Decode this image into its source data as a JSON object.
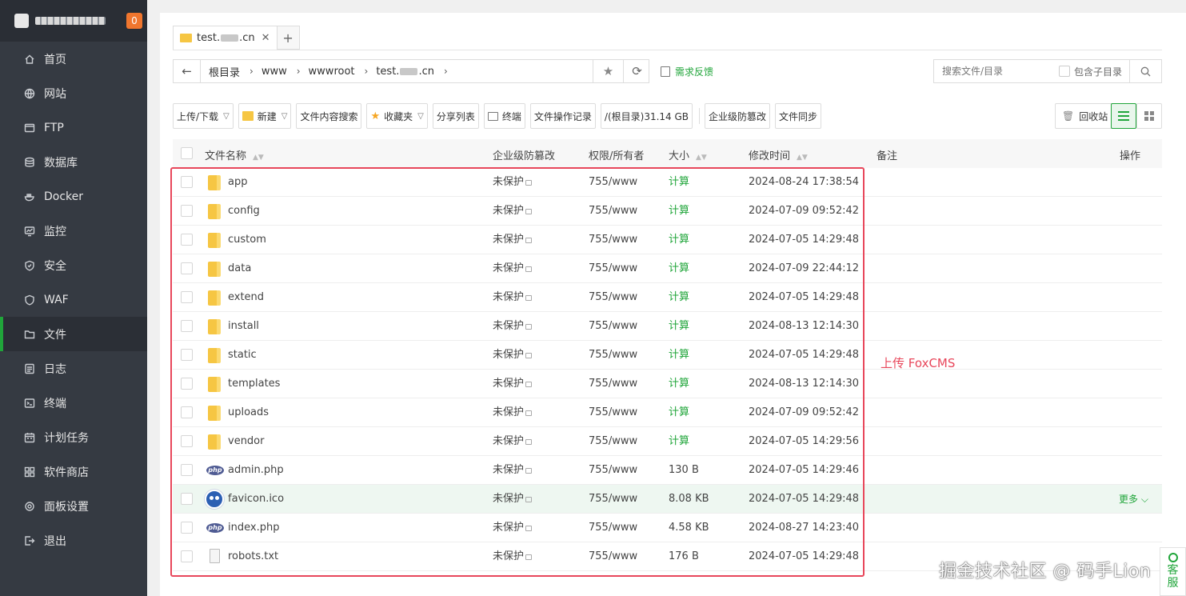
{
  "sidebar": {
    "badge": "0",
    "items": [
      {
        "label": "首页",
        "icon": "home-icon"
      },
      {
        "label": "网站",
        "icon": "globe-icon"
      },
      {
        "label": "FTP",
        "icon": "ftp-icon"
      },
      {
        "label": "数据库",
        "icon": "database-icon"
      },
      {
        "label": "Docker",
        "icon": "docker-icon"
      },
      {
        "label": "监控",
        "icon": "monitor-icon"
      },
      {
        "label": "安全",
        "icon": "shield-icon"
      },
      {
        "label": "WAF",
        "icon": "waf-icon"
      },
      {
        "label": "文件",
        "icon": "folder-icon"
      },
      {
        "label": "日志",
        "icon": "log-icon"
      },
      {
        "label": "终端",
        "icon": "terminal-icon"
      },
      {
        "label": "计划任务",
        "icon": "calendar-icon"
      },
      {
        "label": "软件商店",
        "icon": "apps-icon"
      },
      {
        "label": "面板设置",
        "icon": "gear-icon"
      },
      {
        "label": "退出",
        "icon": "logout-icon"
      }
    ],
    "active_index": 8
  },
  "tabs": {
    "current_prefix": "test.",
    "current_suffix": ".cn",
    "close": "✕",
    "add": "+"
  },
  "path": {
    "back": "←",
    "crumbs": [
      "根目录",
      "www",
      "wwwroot"
    ],
    "last_prefix": "test.",
    "last_suffix": ".cn",
    "star": "★",
    "refresh": "⟳"
  },
  "feedback": "需求反馈",
  "search": {
    "placeholder": "搜索文件/目录",
    "include_sub": "包含子目录"
  },
  "toolbar": {
    "upload": "上传/下载",
    "new": "新建",
    "content_search": "文件内容搜索",
    "favorites": "收藏夹",
    "share_list": "分享列表",
    "terminal": "终端",
    "op_log": "文件操作记录",
    "disk": "/(根目录)31.14 GB",
    "tamper": "企业级防篡改",
    "sync": "文件同步",
    "recycle": "回收站"
  },
  "table": {
    "headers": {
      "name": "文件名称",
      "tamper": "企业级防篡改",
      "perm": "权限/所有者",
      "size": "大小",
      "mtime": "修改时间",
      "note": "备注",
      "ops": "操作"
    },
    "rows": [
      {
        "name": "app",
        "type": "folder",
        "tamper": "未保护",
        "perm": "755/www",
        "size": "计算",
        "mtime": "2024-08-24 17:38:54"
      },
      {
        "name": "config",
        "type": "folder",
        "tamper": "未保护",
        "perm": "755/www",
        "size": "计算",
        "mtime": "2024-07-09 09:52:42"
      },
      {
        "name": "custom",
        "type": "folder",
        "tamper": "未保护",
        "perm": "755/www",
        "size": "计算",
        "mtime": "2024-07-05 14:29:48"
      },
      {
        "name": "data",
        "type": "folder",
        "tamper": "未保护",
        "perm": "755/www",
        "size": "计算",
        "mtime": "2024-07-09 22:44:12"
      },
      {
        "name": "extend",
        "type": "folder",
        "tamper": "未保护",
        "perm": "755/www",
        "size": "计算",
        "mtime": "2024-07-05 14:29:48"
      },
      {
        "name": "install",
        "type": "folder",
        "tamper": "未保护",
        "perm": "755/www",
        "size": "计算",
        "mtime": "2024-08-13 12:14:30"
      },
      {
        "name": "static",
        "type": "folder",
        "tamper": "未保护",
        "perm": "755/www",
        "size": "计算",
        "mtime": "2024-07-05 14:29:48"
      },
      {
        "name": "templates",
        "type": "folder",
        "tamper": "未保护",
        "perm": "755/www",
        "size": "计算",
        "mtime": "2024-08-13 12:14:30"
      },
      {
        "name": "uploads",
        "type": "folder",
        "tamper": "未保护",
        "perm": "755/www",
        "size": "计算",
        "mtime": "2024-07-09 09:52:42"
      },
      {
        "name": "vendor",
        "type": "folder",
        "tamper": "未保护",
        "perm": "755/www",
        "size": "计算",
        "mtime": "2024-07-05 14:29:56"
      },
      {
        "name": "admin.php",
        "type": "php",
        "tamper": "未保护",
        "perm": "755/www",
        "size": "130 B",
        "mtime": "2024-07-05 14:29:46"
      },
      {
        "name": "favicon.ico",
        "type": "ico",
        "tamper": "未保护",
        "perm": "755/www",
        "size": "8.08 KB",
        "mtime": "2024-07-05 14:29:48",
        "more": "更多"
      },
      {
        "name": "index.php",
        "type": "php",
        "tamper": "未保护",
        "perm": "755/www",
        "size": "4.58 KB",
        "mtime": "2024-08-27 14:23:40"
      },
      {
        "name": "robots.txt",
        "type": "txt",
        "tamper": "未保护",
        "perm": "755/www",
        "size": "176 B",
        "mtime": "2024-07-05 14:29:48"
      }
    ]
  },
  "annotation": "上传 FoxCMS",
  "watermark": "掘金技术社区 @ 码手Lion",
  "kefu": [
    "客",
    "服"
  ],
  "colors": {
    "accent": "#20a53a",
    "highlight": "#e8475b",
    "sidebar": "#353a42"
  }
}
